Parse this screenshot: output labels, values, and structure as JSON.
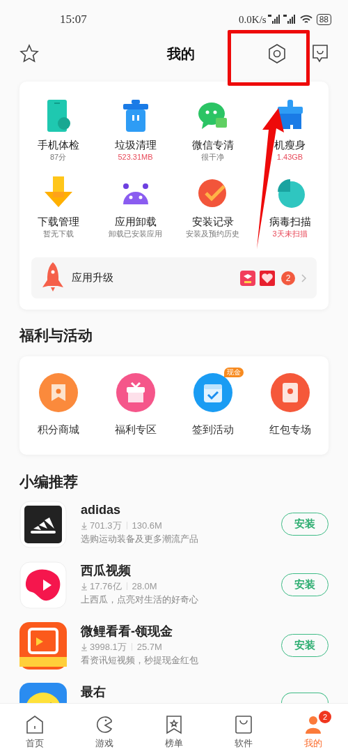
{
  "status_bar": {
    "time": "15:07",
    "net_speed": "0.0K/s",
    "battery": "88"
  },
  "header": {
    "title": "我的"
  },
  "tools": [
    {
      "label": "手机体检",
      "sub": "87分",
      "alert": false,
      "kind": "phone"
    },
    {
      "label": "垃圾清理",
      "sub": "523.31MB",
      "alert": true,
      "kind": "trash"
    },
    {
      "label": "微信专清",
      "sub": "很干净",
      "alert": false,
      "kind": "chat"
    },
    {
      "label": "机瘦身",
      "sub": "1.43GB",
      "alert": true,
      "kind": "brush"
    },
    {
      "label": "下载管理",
      "sub": "暂无下载",
      "alert": false,
      "kind": "download"
    },
    {
      "label": "应用卸载",
      "sub": "卸载已安装应用",
      "alert": false,
      "kind": "robot"
    },
    {
      "label": "安装记录",
      "sub": "安装及预约历史",
      "alert": false,
      "kind": "check"
    },
    {
      "label": "病毒扫描",
      "sub": "3天未扫描",
      "alert": true,
      "kind": "scan"
    }
  ],
  "upgrade": {
    "label": "应用升级",
    "count": "2"
  },
  "welfare": {
    "title": "福利与活动",
    "items": [
      {
        "label": "积分商城",
        "kind": "shop"
      },
      {
        "label": "福利专区",
        "kind": "gift"
      },
      {
        "label": "签到活动",
        "kind": "calendar",
        "badge": "现金"
      },
      {
        "label": "红包专场",
        "kind": "envelope"
      }
    ]
  },
  "recommend": {
    "title": "小编推荐",
    "apps": [
      {
        "name": "adidas",
        "downloads": "701.3万",
        "size": "130.6M",
        "desc": "选购运动装备及更多潮流产品",
        "button": "安装",
        "kind": "stripes"
      },
      {
        "name": "西瓜视频",
        "downloads": "17.76亿",
        "size": "28.0M",
        "desc": "上西瓜，点亮对生活的好奇心",
        "button": "安装",
        "kind": "play"
      },
      {
        "name": "微鲤看看-领现金",
        "downloads": "3998.1万",
        "size": "25.7M",
        "desc": "看资讯短视频，秒提现金红包",
        "button": "安装",
        "kind": "orange"
      },
      {
        "name": "最右",
        "kind": "smile"
      }
    ]
  },
  "nav": [
    {
      "label": "首页",
      "selected": false,
      "kind": "home"
    },
    {
      "label": "游戏",
      "selected": false,
      "kind": "game"
    },
    {
      "label": "榜单",
      "selected": false,
      "kind": "rank"
    },
    {
      "label": "软件",
      "selected": false,
      "kind": "bag"
    },
    {
      "label": "我的",
      "selected": true,
      "kind": "me",
      "badge": "2"
    }
  ]
}
